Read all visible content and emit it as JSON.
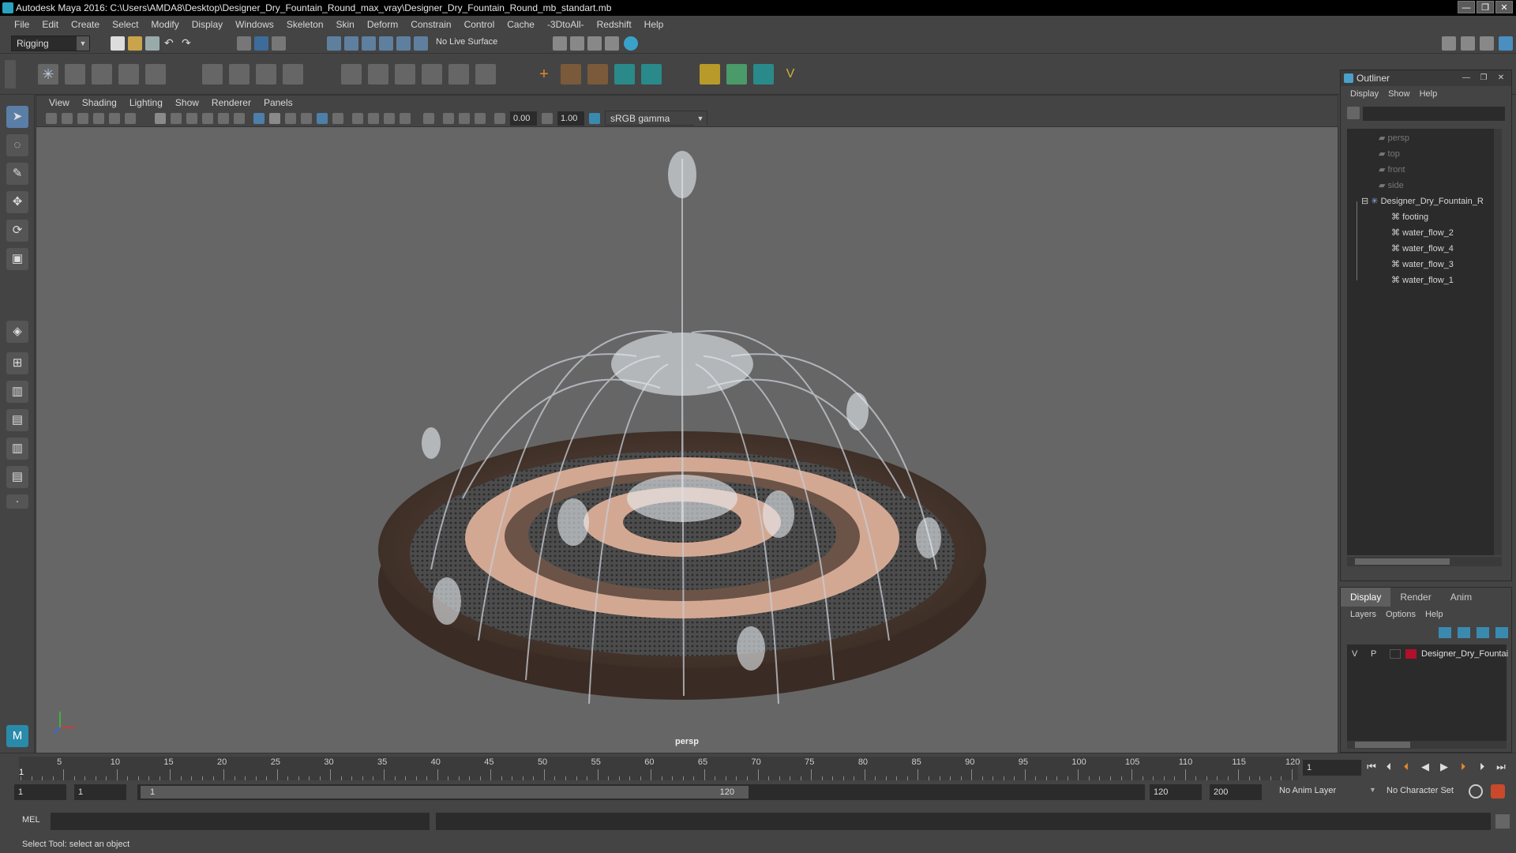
{
  "window": {
    "title": "Autodesk Maya 2016: C:\\Users\\AMDA8\\Desktop\\Designer_Dry_Fountain_Round_max_vray\\Designer_Dry_Fountain_Round_mb_standart.mb",
    "minimize": "—",
    "maximize": "❐",
    "close": "✕"
  },
  "menubar": [
    "File",
    "Edit",
    "Create",
    "Select",
    "Modify",
    "Display",
    "Windows",
    "Skeleton",
    "Skin",
    "Deform",
    "Constrain",
    "Control",
    "Cache",
    "-3DtoAll-",
    "Redshift",
    "Help"
  ],
  "statusline": {
    "menuset": "Rigging",
    "live_surface": "No Live Surface"
  },
  "viewport": {
    "menus": [
      "View",
      "Shading",
      "Lighting",
      "Show",
      "Renderer",
      "Panels"
    ],
    "exposure": "0.00",
    "gamma": "1.00",
    "color_space": "sRGB gamma",
    "camera": "persp"
  },
  "outliner": {
    "title": "Outliner",
    "menus": [
      "Display",
      "Show",
      "Help"
    ],
    "items": [
      {
        "label": "persp",
        "dim": true
      },
      {
        "label": "top",
        "dim": true
      },
      {
        "label": "front",
        "dim": true
      },
      {
        "label": "side",
        "dim": true
      },
      {
        "label": "Designer_Dry_Fountain_R",
        "dim": false
      },
      {
        "label": "footing",
        "dim": false
      },
      {
        "label": "water_flow_2",
        "dim": false
      },
      {
        "label": "water_flow_4",
        "dim": false
      },
      {
        "label": "water_flow_3",
        "dim": false
      },
      {
        "label": "water_flow_1",
        "dim": false
      }
    ]
  },
  "layers": {
    "tabs": [
      "Display",
      "Render",
      "Anim"
    ],
    "active_tab": "Display",
    "menus": [
      "Layers",
      "Options",
      "Help"
    ],
    "row": {
      "v": "V",
      "p": "P",
      "name": "Designer_Dry_Fountai",
      "color": "#b0102a"
    }
  },
  "timeline": {
    "ticks": [
      "5",
      "10",
      "15",
      "20",
      "25",
      "30",
      "35",
      "40",
      "45",
      "50",
      "55",
      "60",
      "65",
      "70",
      "75",
      "80",
      "85",
      "90",
      "95",
      "100",
      "105",
      "110",
      "115",
      "120"
    ],
    "start_label": "1",
    "current_frame": "1"
  },
  "range": {
    "start": "1",
    "playback_start": "1",
    "slider_start": "1",
    "slider_end": "120",
    "playback_end": "120",
    "end": "200",
    "anim_layer": "No Anim Layer",
    "character_set": "No Character Set"
  },
  "commandline": {
    "label": "MEL"
  },
  "helpline": {
    "text": "Select Tool: select an object"
  }
}
